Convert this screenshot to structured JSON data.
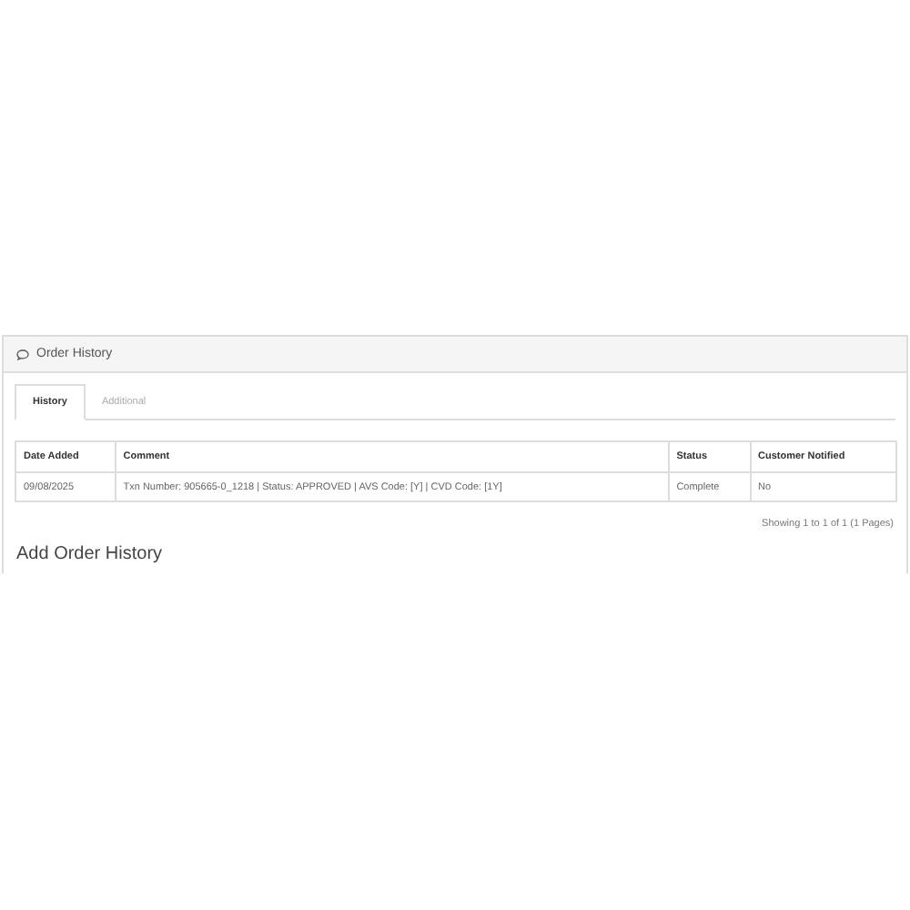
{
  "panel": {
    "title": "Order History"
  },
  "tabs": [
    {
      "label": "History",
      "selected": true
    },
    {
      "label": "Additional",
      "selected": false
    }
  ],
  "table": {
    "columns": [
      "Date Added",
      "Comment",
      "Status",
      "Customer Notified"
    ],
    "rows": [
      [
        "09/08/2025",
        "Txn Number: 905665-0_1218 | Status: APPROVED | AVS Code: [Y] | CVD Code: [1Y]",
        "Complete",
        "No"
      ]
    ]
  },
  "pagination": "Showing 1 to 1 of 1 (1 Pages)",
  "section_title": "Add Order History"
}
